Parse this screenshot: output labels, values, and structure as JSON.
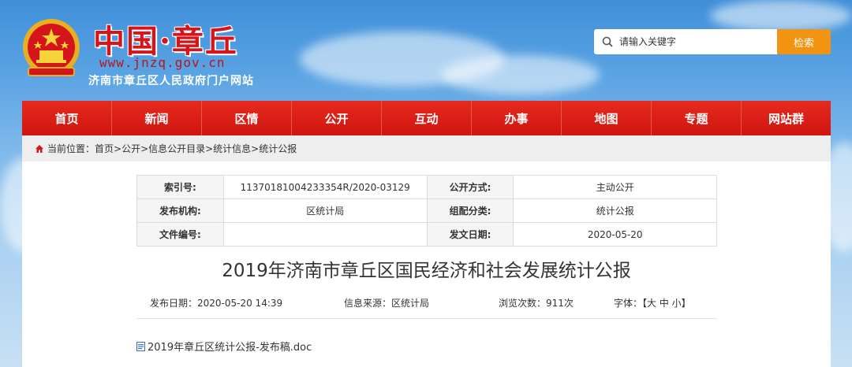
{
  "header": {
    "logo_cn": "中国·章丘",
    "logo_url": "www.jnzq.gov.cn",
    "logo_sub": "济南市章丘区人民政府门户网站"
  },
  "search": {
    "placeholder": "请输入关键字",
    "button": "检索"
  },
  "nav": {
    "items": [
      "首页",
      "新闻",
      "区情",
      "公开",
      "互动",
      "办事",
      "地图",
      "专题",
      "网站群"
    ]
  },
  "breadcrumb": {
    "label": "当前位置：",
    "path": "首页>公开>信息公开目录>统计信息>统计公报"
  },
  "meta": {
    "index_label": "索引号:",
    "index_value": "11370181004233354R/2020-03129",
    "disclosure_label": "公开方式:",
    "disclosure_value": "主动公开",
    "issuer_label": "发布机构:",
    "issuer_value": "区统计局",
    "category_label": "组配分类:",
    "category_value": "统计公报",
    "docno_label": "文件编号:",
    "docno_value": "",
    "date_label": "发文日期:",
    "date_value": "2020-05-20"
  },
  "article": {
    "title": "2019年济南市章丘区国民经济和社会发展统计公报",
    "publish_date": "发布日期：2020-05-20 14:39",
    "source": "信息来源：区统计局",
    "views": "浏览次数：911次",
    "font_size": "字体：【大 中 小】",
    "attachment": "2019年章丘区统计公报-发布稿.doc"
  },
  "colors": {
    "nav_red": "#d6181b",
    "search_orange": "#f39312",
    "logo_red": "#d4161c"
  }
}
